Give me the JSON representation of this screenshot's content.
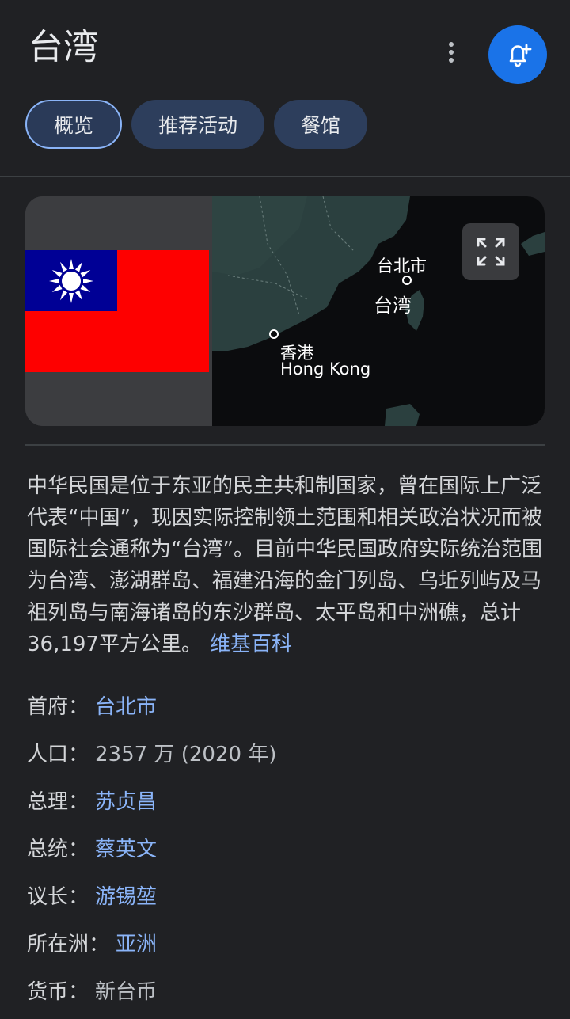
{
  "header": {
    "title": "台湾",
    "more_icon": "more-vert-icon",
    "bell_icon": "add-alert-icon"
  },
  "tabs": [
    {
      "label": "概览",
      "active": true
    },
    {
      "label": "推荐活动",
      "active": false
    },
    {
      "label": "餐馆",
      "active": false
    }
  ],
  "map": {
    "label_taipei": "台北市",
    "label_taiwan": "台湾",
    "label_hk_zh": "香港",
    "label_hk_en": "Hong Kong",
    "expand_icon": "fullscreen-icon"
  },
  "description": {
    "text": "中华民国是位于东亚的民主共和制国家，曾在国际上广泛代表“中国”，现因实际控制领土范围和相关政治状况而被国际社会通称为“台湾”。目前中华民国政府实际统治范围为台湾、澎湖群岛、福建沿海的金门列岛、乌坵列屿及马祖列岛与南海诸岛的东沙群岛、太平岛和中洲礁，总计36,197平方公里。",
    "source_link": "维基百科"
  },
  "facts": [
    {
      "label": "首府：",
      "value": "台北市"
    },
    {
      "label": "人口：",
      "value": "2357 万 (2020 年)"
    },
    {
      "label": "总理：",
      "value": "苏贞昌"
    },
    {
      "label": "总统：",
      "value": "蔡英文"
    },
    {
      "label": "议长：",
      "value": "游锡堃"
    },
    {
      "label": "所在洲：",
      "value": "亚洲"
    },
    {
      "label": "货币：",
      "value": "新台币"
    }
  ],
  "colors": {
    "background": "#202124",
    "accent_blue": "#1a73e8",
    "link": "#8ab4f8",
    "tab_bg": "#2d3e5c"
  }
}
